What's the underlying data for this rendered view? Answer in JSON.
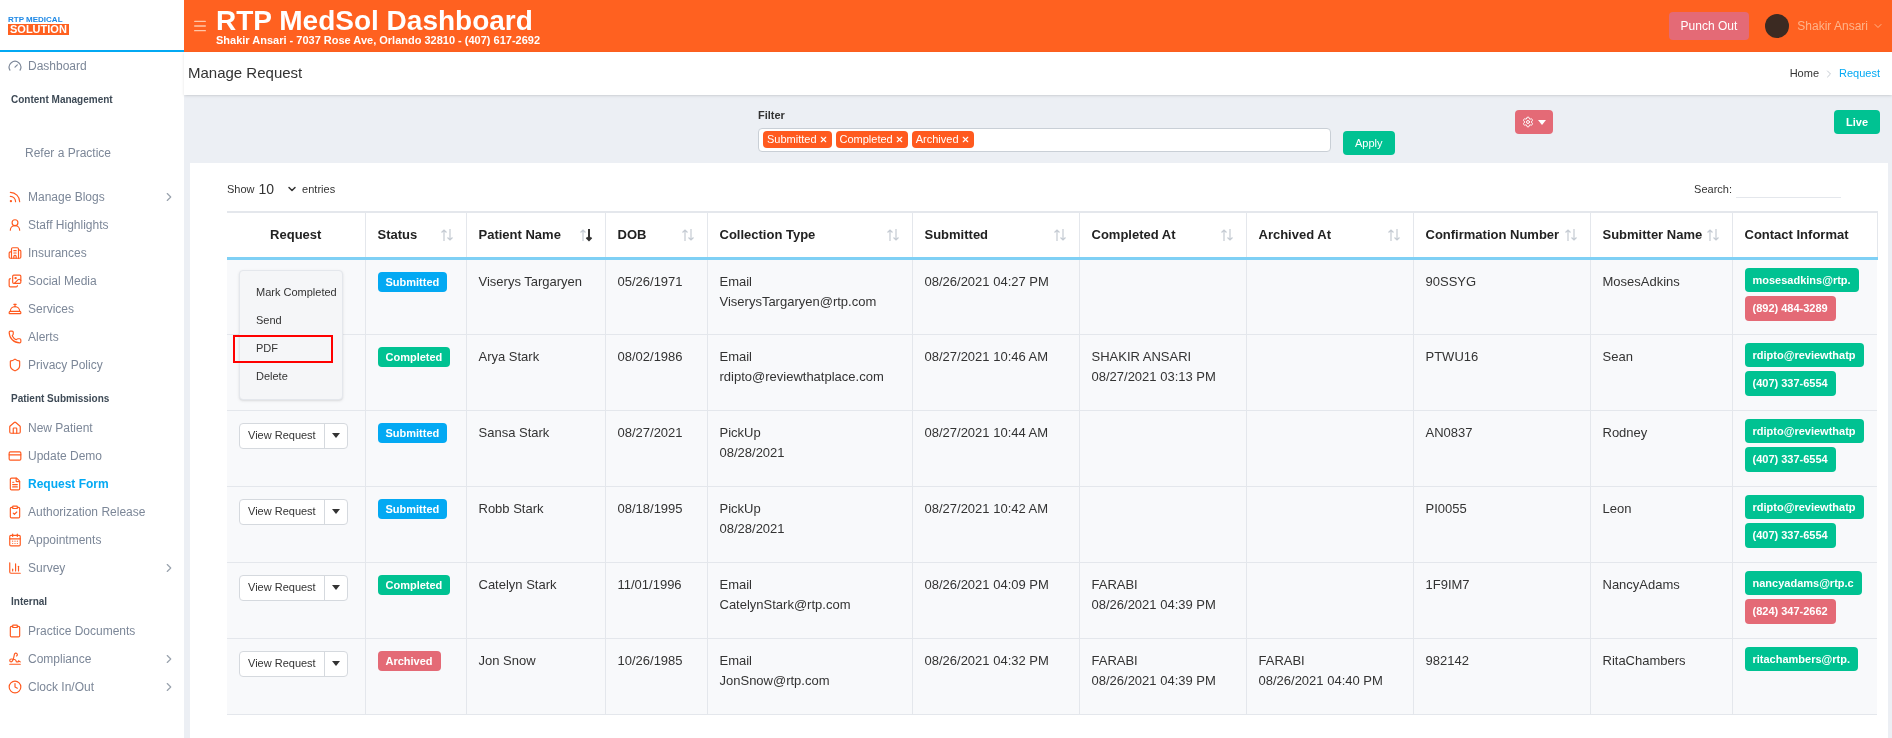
{
  "logo": {
    "line1": "RTP MEDICAL",
    "line2": "SOLUTION"
  },
  "header": {
    "title": "RTP MedSol Dashboard",
    "subtitle": "Shakir Ansari - 7037 Rose Ave, Orlando 32810 - (407) 617-2692",
    "punch_out": "Punch Out",
    "user_name": "Shakir Ansari"
  },
  "sidebar": {
    "sections": [
      {
        "items": [
          {
            "label": "Dashboard",
            "selected": false,
            "has_submenu": false
          }
        ]
      },
      {
        "heading": "Content Management",
        "items": [
          {
            "label": "Refer a Practice",
            "selected": false,
            "has_submenu": false
          },
          {
            "label": "Manage Blogs",
            "selected": false,
            "has_submenu": true
          },
          {
            "label": "Staff Highlights",
            "selected": false,
            "has_submenu": false
          },
          {
            "label": "Insurances",
            "selected": false,
            "has_submenu": false
          },
          {
            "label": "Social Media",
            "selected": false,
            "has_submenu": false
          },
          {
            "label": "Services",
            "selected": false,
            "has_submenu": false
          },
          {
            "label": "Alerts",
            "selected": false,
            "has_submenu": false
          },
          {
            "label": "Privacy Policy",
            "selected": false,
            "has_submenu": false
          }
        ]
      },
      {
        "heading": "Patient Submissions",
        "items": [
          {
            "label": "New Patient",
            "selected": false,
            "has_submenu": false
          },
          {
            "label": "Update Demo",
            "selected": false,
            "has_submenu": false
          },
          {
            "label": "Request Form",
            "selected": true,
            "has_submenu": false
          },
          {
            "label": "Authorization Release",
            "selected": false,
            "has_submenu": false
          },
          {
            "label": "Appointments",
            "selected": false,
            "has_submenu": false
          },
          {
            "label": "Survey",
            "selected": false,
            "has_submenu": true
          }
        ]
      },
      {
        "heading": "Internal",
        "items": [
          {
            "label": "Practice Documents",
            "selected": false,
            "has_submenu": false
          },
          {
            "label": "Compliance",
            "selected": false,
            "has_submenu": true
          },
          {
            "label": "Clock In/Out",
            "selected": false,
            "has_submenu": true
          }
        ]
      }
    ]
  },
  "page": {
    "title": "Manage Request",
    "breadcrumb": [
      {
        "label": "Home",
        "selected": false
      },
      {
        "label": "Request",
        "selected": true
      }
    ]
  },
  "filter": {
    "label": "Filter",
    "tags": [
      "Submitted",
      "Completed",
      "Archived"
    ],
    "apply": "Apply",
    "live": "Live"
  },
  "table_controls": {
    "show": "Show",
    "entries_value": "10",
    "entries": "entries",
    "search": "Search:"
  },
  "columns": [
    {
      "label": "Request",
      "sortable": false
    },
    {
      "label": "Status",
      "sortable": true,
      "sorted_desc": false
    },
    {
      "label": "Patient Name",
      "sortable": true,
      "sorted_desc": true
    },
    {
      "label": "DOB",
      "sortable": true,
      "sorted_desc": false
    },
    {
      "label": "Collection Type",
      "sortable": true,
      "sorted_desc": false
    },
    {
      "label": "Submitted",
      "sortable": true,
      "sorted_desc": false
    },
    {
      "label": "Completed At",
      "sortable": true,
      "sorted_desc": false
    },
    {
      "label": "Archived At",
      "sortable": true,
      "sorted_desc": false
    },
    {
      "label": "Confirmation Number",
      "sortable": true,
      "sorted_desc": false
    },
    {
      "label": "Submitter Name",
      "sortable": true,
      "sorted_desc": false
    },
    {
      "label": "Contact Informat",
      "sortable": false
    }
  ],
  "action_menu": {
    "items": [
      {
        "label": "Mark Completed",
        "highlighted": false
      },
      {
        "label": "Send",
        "highlighted": false
      },
      {
        "label": "PDF",
        "highlighted": true
      },
      {
        "label": "Delete",
        "highlighted": false
      }
    ]
  },
  "rows": [
    {
      "status": {
        "label": "Submitted",
        "kind": "submitted"
      },
      "patient": "Viserys Targaryen",
      "dob": "05/26/1971",
      "collection": [
        "Email",
        "ViserysTargaryen@rtp.com"
      ],
      "submitted": "08/26/2021 04:27 PM",
      "completed": [],
      "archived": [],
      "confirmation": "90SSYG",
      "submitter": "MosesAdkins",
      "contacts": [
        {
          "text": "mosesadkins@rtp.",
          "color": "#00c292"
        },
        {
          "text": "(892) 484-3289",
          "color": "#e46a76"
        }
      ]
    },
    {
      "status": {
        "label": "Completed",
        "kind": "completed"
      },
      "patient": "Arya Stark",
      "dob": "08/02/1986",
      "collection": [
        "Email",
        "rdipto@reviewthatplace.com"
      ],
      "submitted": "08/27/2021 10:46 AM",
      "completed": [
        "SHAKIR ANSARI",
        "08/27/2021 03:13 PM"
      ],
      "archived": [],
      "confirmation": "PTWU16",
      "submitter": "Sean",
      "contacts": [
        {
          "text": "rdipto@reviewthatp",
          "color": "#00c292"
        },
        {
          "text": "(407) 337-6554",
          "color": "#00c292"
        }
      ]
    },
    {
      "request_button": "View Request",
      "status": {
        "label": "Submitted",
        "kind": "submitted"
      },
      "patient": "Sansa Stark",
      "dob": "08/27/2021",
      "collection": [
        "PickUp",
        "08/28/2021"
      ],
      "submitted": "08/27/2021 10:44 AM",
      "completed": [],
      "archived": [],
      "confirmation": "AN0837",
      "submitter": "Rodney",
      "contacts": [
        {
          "text": "rdipto@reviewthatp",
          "color": "#00c292"
        },
        {
          "text": "(407) 337-6554",
          "color": "#00c292"
        }
      ]
    },
    {
      "request_button": "View Request",
      "status": {
        "label": "Submitted",
        "kind": "submitted"
      },
      "patient": "Robb Stark",
      "dob": "08/18/1995",
      "collection": [
        "PickUp",
        "08/28/2021"
      ],
      "submitted": "08/27/2021 10:42 AM",
      "completed": [],
      "archived": [],
      "confirmation": "PI0055",
      "submitter": "Leon",
      "contacts": [
        {
          "text": "rdipto@reviewthatp",
          "color": "#00c292"
        },
        {
          "text": "(407) 337-6554",
          "color": "#00c292"
        }
      ]
    },
    {
      "request_button": "View Request",
      "status": {
        "label": "Completed",
        "kind": "completed"
      },
      "patient": "Catelyn Stark",
      "dob": "11/01/1996",
      "collection": [
        "Email",
        "CatelynStark@rtp.com"
      ],
      "submitted": "08/26/2021 04:09 PM",
      "completed": [
        "FARABI",
        "08/26/2021 04:39 PM"
      ],
      "archived": [],
      "confirmation": "1F9IM7",
      "submitter": "NancyAdams",
      "contacts": [
        {
          "text": "nancyadams@rtp.c",
          "color": "#00c292"
        },
        {
          "text": "(824) 347-2662",
          "color": "#e46a76"
        }
      ]
    },
    {
      "request_button": "View Request",
      "status": {
        "label": "Archived",
        "kind": "archived"
      },
      "patient": "Jon Snow",
      "dob": "10/26/1985",
      "collection": [
        "Email",
        "JonSnow@rtp.com"
      ],
      "submitted": "08/26/2021 04:32 PM",
      "completed": [
        "FARABI",
        "08/26/2021 04:39 PM"
      ],
      "archived": [
        "FARABI",
        "08/26/2021 04:40 PM"
      ],
      "confirmation": "982142",
      "submitter": "RitaChambers",
      "contacts": [
        {
          "text": "ritachambers@rtp.",
          "color": "#00c292"
        }
      ]
    }
  ]
}
